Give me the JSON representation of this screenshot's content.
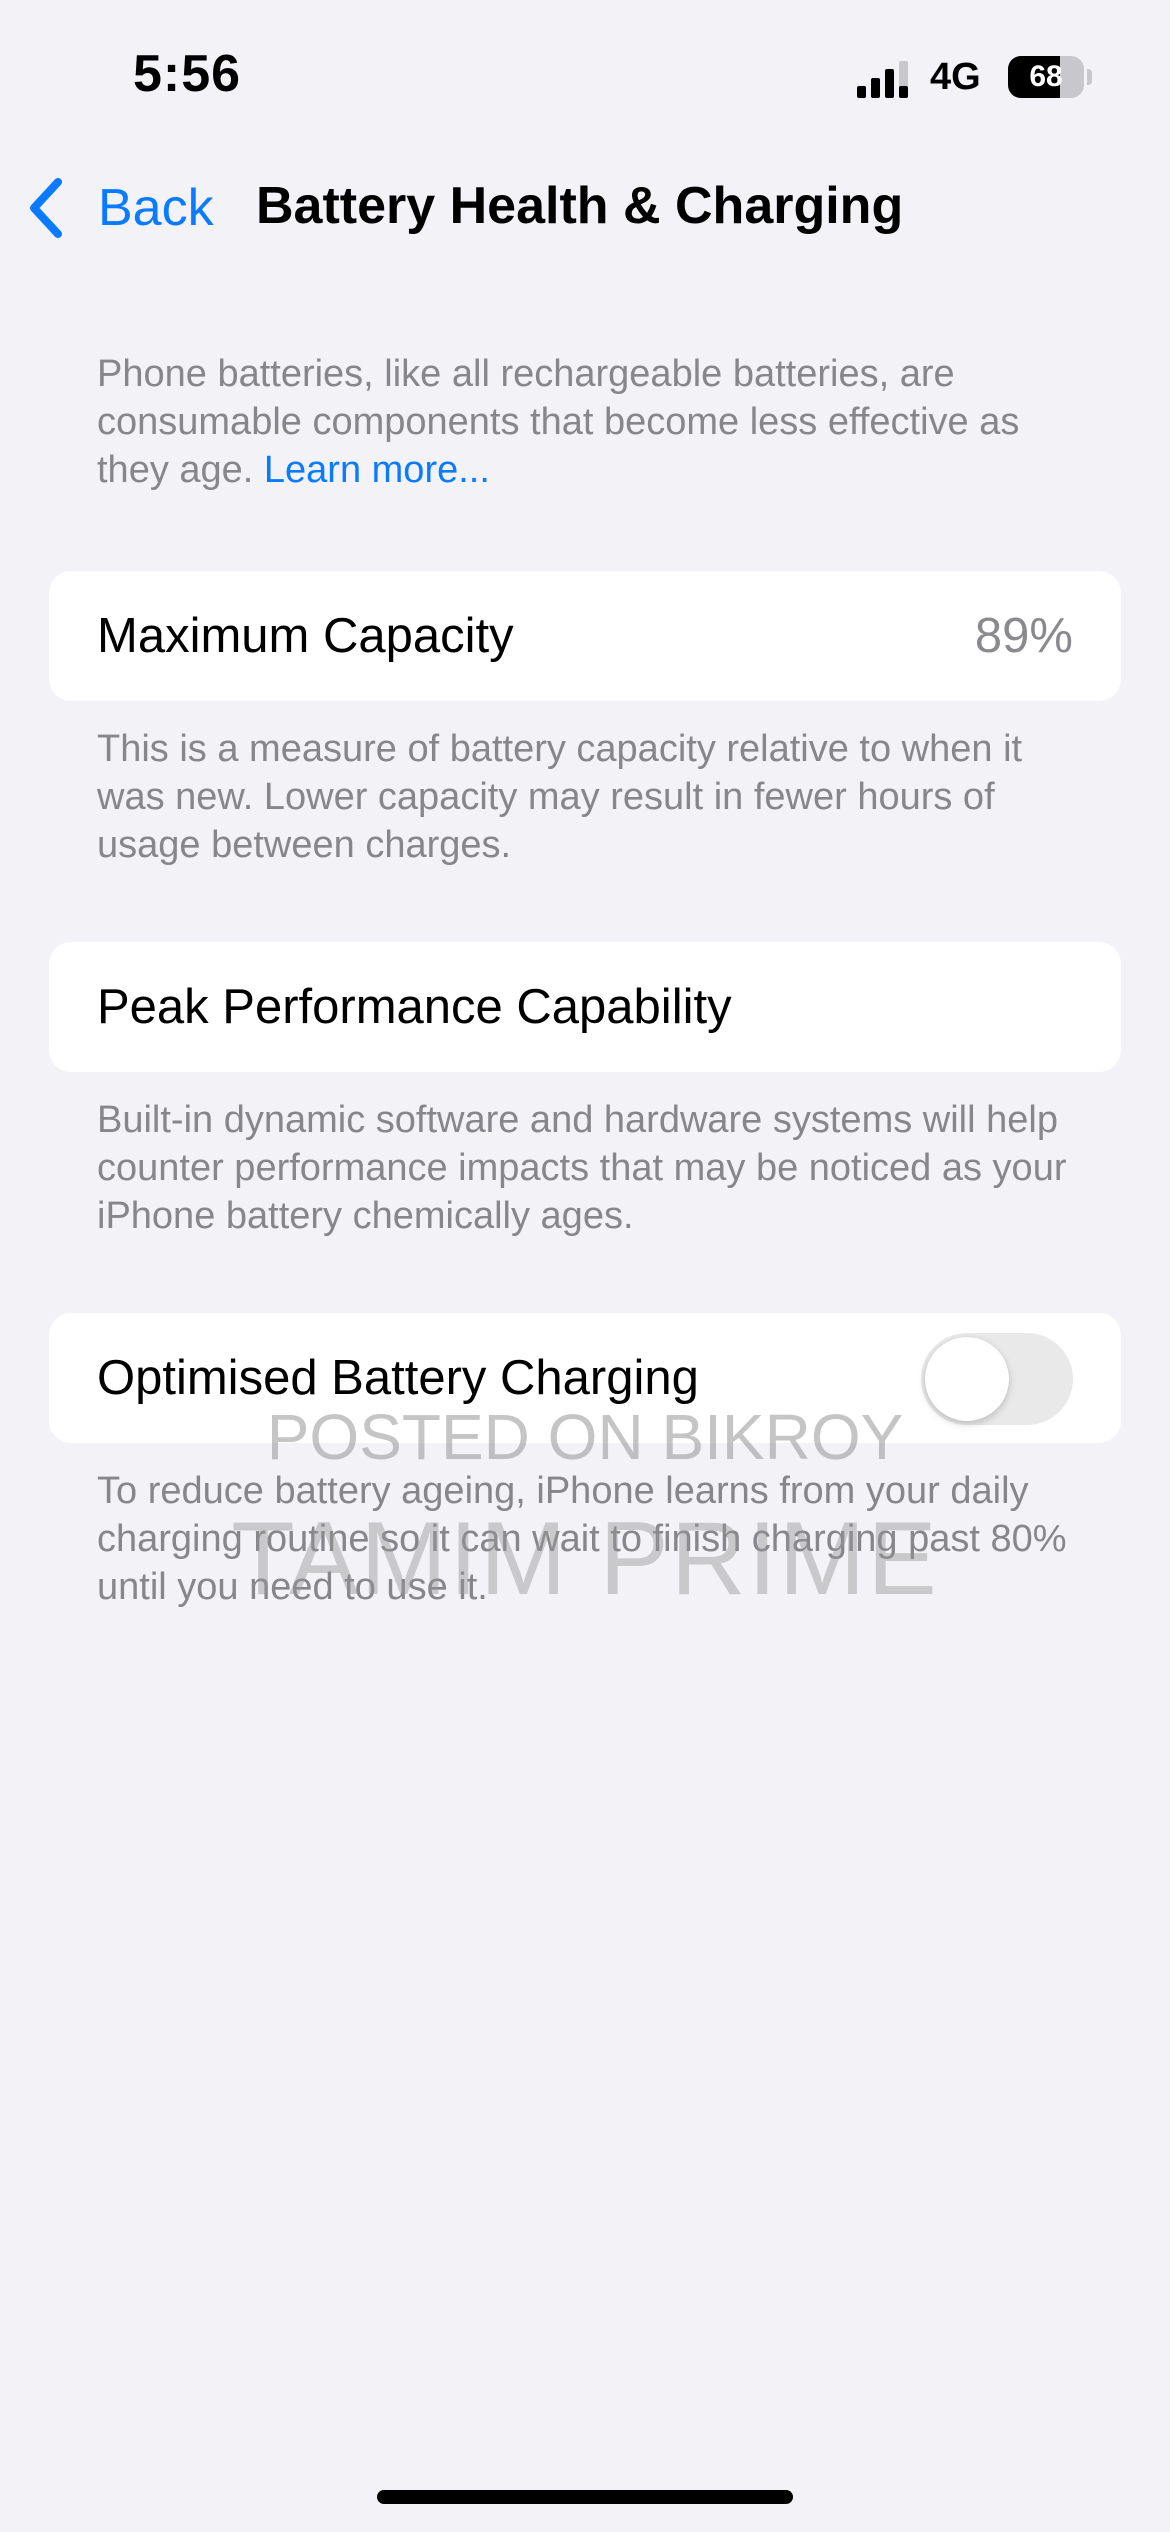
{
  "status_bar": {
    "time": "5:56",
    "network": "4G",
    "battery_percent": "68",
    "battery_level": 0.68,
    "signal_icon": "cellular-signal-icon",
    "battery_icon": "battery-icon"
  },
  "nav": {
    "back_label": "Back",
    "back_icon": "chevron-left-icon",
    "title": "Battery Health & Charging"
  },
  "intro": {
    "text": "Phone batteries, like all rechargeable batteries, are consumable components that become less effective as they age. ",
    "link": "Learn more..."
  },
  "max_capacity": {
    "label": "Maximum Capacity",
    "value": "89%",
    "description": "This is a measure of battery capacity relative to when it was new. Lower capacity may result in fewer hours of usage between charges."
  },
  "peak_performance": {
    "label": "Peak Performance Capability",
    "description": "Built-in dynamic software and hardware systems will help counter performance impacts that may be noticed as your iPhone battery chemically ages."
  },
  "optimised_charging": {
    "label": "Optimised Battery Charging",
    "enabled": false,
    "description": "To reduce battery ageing, iPhone learns from your daily charging routine so it can wait to finish charging past 80% until you need to use it."
  },
  "watermark": {
    "line1": "POSTED ON BIKROY",
    "line2": "TAMIM PRIME"
  },
  "colors": {
    "background": "#f2f2f7",
    "card": "#ffffff",
    "accent": "#0a7aff",
    "secondary_text": "#86868b",
    "toggle_off": "#e9e9ea"
  }
}
